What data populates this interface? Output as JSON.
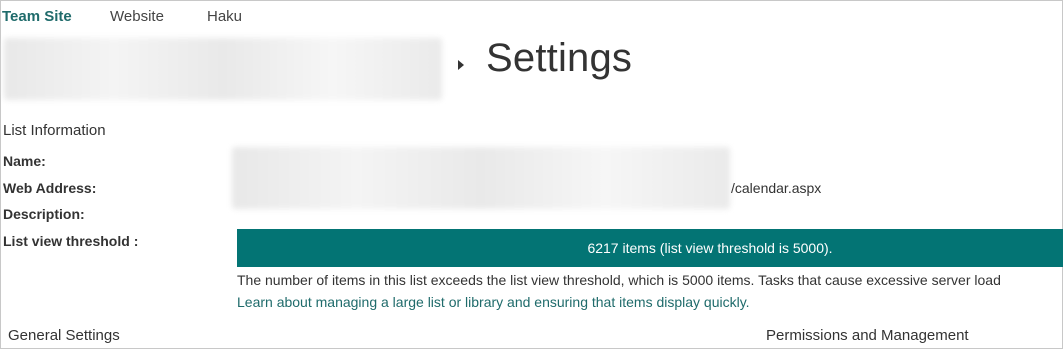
{
  "nav": {
    "tabs": [
      {
        "label": "Team Site",
        "active": true
      },
      {
        "label": "Website",
        "active": false
      },
      {
        "label": "Haku",
        "active": false
      }
    ]
  },
  "header": {
    "title": "Settings"
  },
  "list_info": {
    "section_title": "List Information",
    "name_label": "Name:",
    "web_address_label": "Web Address:",
    "web_address_suffix": "/calendar.aspx",
    "description_label": "Description:",
    "threshold_label": "List view threshold :",
    "threshold_status": "6217 items (list view threshold is 5000).",
    "warning_text": "The number of items in this list exceeds the list view threshold, which is 5000 items. Tasks that cause excessive server load",
    "learn_link": "Learn about managing a large list or library and ensuring that items display quickly."
  },
  "footer": {
    "general_settings": "General Settings",
    "permissions": "Permissions and Management"
  },
  "colors": {
    "accent": "#037474",
    "link": "#1f6b6b"
  }
}
